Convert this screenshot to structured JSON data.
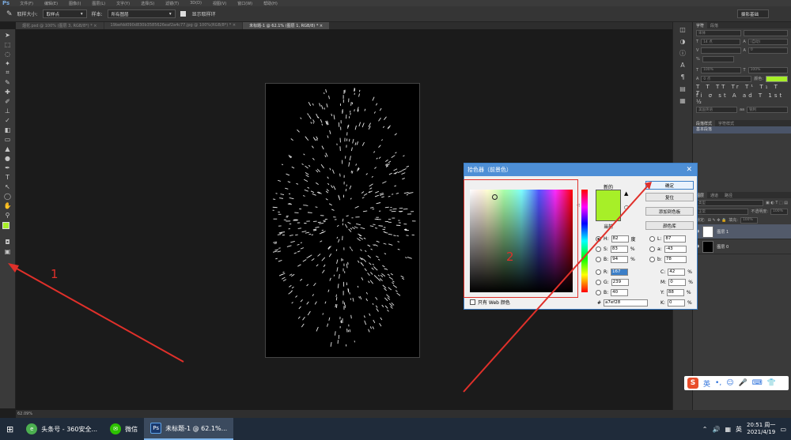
{
  "menubar": {
    "logo": "Ps",
    "items": [
      "文件(F)",
      "编辑(E)",
      "图像(I)",
      "图层(L)",
      "文字(Y)",
      "选择(S)",
      "滤镜(T)",
      "3D(D)",
      "视图(V)",
      "窗口(W)",
      "帮助(H)"
    ]
  },
  "options": {
    "sample_size_label": "取样大小:",
    "sample_size_value": "取样点",
    "sample_label": "样本:",
    "sample_value": "所有图层",
    "show_ring_label": "显示取样环",
    "workspace": "摄影基础"
  },
  "tabs": [
    {
      "label": "烟花.psd @ 100% (图层 3, RGB/8*) *",
      "active": false
    },
    {
      "label": "19befdd090d830b3585626eaf2a4c77.jpg @ 100%(RGB/8*) *",
      "active": false
    },
    {
      "label": "未标题-1 @ 62.1% (图层 1, RGB/8) *",
      "active": true
    }
  ],
  "right_panel": {
    "char_tabs": [
      "字符",
      "段落"
    ],
    "font_family": "宋体",
    "font_size": "14 点",
    "leading": "(自动)",
    "tracking": "0",
    "scale_v": "100%",
    "scale_h": "100%",
    "baseline": "0 点",
    "color_label": "颜色:",
    "lang": "美国英语",
    "aa": "锐利",
    "style_tabs": [
      "段落样式",
      "字符样式"
    ],
    "style_item": "基本段落",
    "layer_tabs": [
      "图层",
      "通道",
      "路径"
    ],
    "kind_label": "类型",
    "blend": "正常",
    "opacity_label": "不透明度:",
    "opacity": "100%",
    "lock_label": "锁定:",
    "fill_label": "填充:",
    "fill": "100%",
    "layers": [
      {
        "name": "图层 1",
        "selected": true
      },
      {
        "name": "图层 0",
        "selected": false
      }
    ]
  },
  "status": {
    "zoom": "62.09%"
  },
  "dialog": {
    "title": "拾色器（前景色）",
    "new_label": "新的",
    "current_label": "当前",
    "ok": "确定",
    "reset": "复位",
    "add_swatch": "添加到色板",
    "libraries": "颜色库",
    "web_only": "只有 Web 颜色",
    "hsb": [
      {
        "label": "H:",
        "value": "82",
        "unit": "度",
        "on": true
      },
      {
        "label": "S:",
        "value": "83",
        "unit": "%",
        "on": false
      },
      {
        "label": "B:",
        "value": "94",
        "unit": "%",
        "on": false
      }
    ],
    "rgb": [
      {
        "label": "R:",
        "value": "167",
        "on": false,
        "hl": true
      },
      {
        "label": "G:",
        "value": "239",
        "on": false,
        "hl": false
      },
      {
        "label": "B:",
        "value": "40",
        "on": false,
        "hl": false
      }
    ],
    "lab": [
      {
        "label": "L:",
        "value": "87"
      },
      {
        "label": "a:",
        "value": "-43"
      },
      {
        "label": "b:",
        "value": "78"
      }
    ],
    "cmyk": [
      {
        "label": "C:",
        "value": "42",
        "unit": "%"
      },
      {
        "label": "M:",
        "value": "0",
        "unit": "%"
      },
      {
        "label": "Y:",
        "value": "88",
        "unit": "%"
      },
      {
        "label": "K:",
        "value": "0",
        "unit": "%"
      }
    ],
    "hex_label": "#",
    "hex": "a7ef28",
    "new_color": "#a7ef28",
    "current_color": "#a7ef28"
  },
  "annotations": {
    "one": "1",
    "two": "2"
  },
  "taskbar": {
    "items": [
      {
        "label": "头条号 - 360安全...",
        "color": "#4caf50",
        "icon": "browser-icon"
      },
      {
        "label": "微信",
        "color": "#2dc100",
        "icon": "wechat-icon"
      },
      {
        "label": "未标题-1 @ 62.1%...",
        "color": "#1a3a6e",
        "icon": "ps-icon"
      }
    ],
    "ime": "英",
    "time": "20:51 周一",
    "date": "2021/4/19"
  },
  "ime_bar": {
    "s": "S",
    "lang": "英"
  },
  "colors": {
    "foreground": "#a7ef28",
    "accent": "#4e8fd6",
    "annotation": "#e0302a"
  }
}
